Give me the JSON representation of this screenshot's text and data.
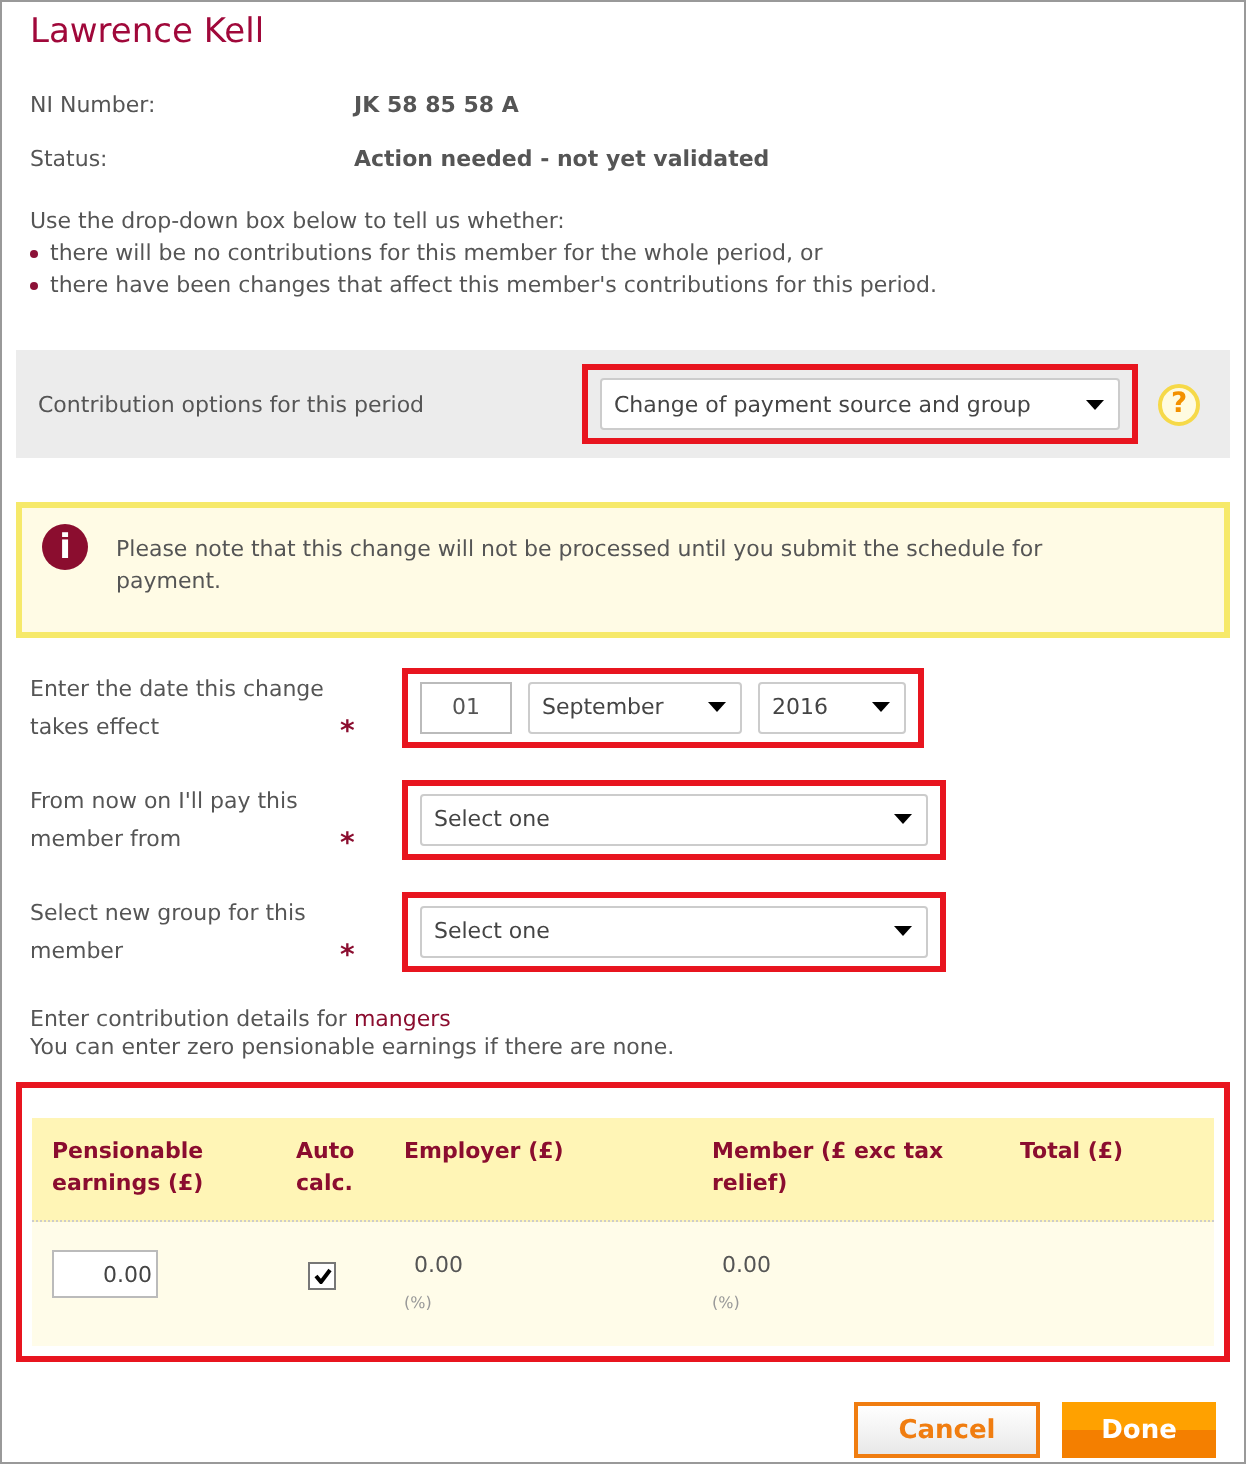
{
  "title": "Lawrence Kell",
  "details": [
    {
      "label": "NI Number:",
      "value": "JK 58 85 58 A"
    },
    {
      "label": "Status:",
      "value": "Action needed - not yet validated"
    }
  ],
  "instructions": {
    "intro": "Use the drop-down box below to tell us whether:",
    "bullets": [
      "there will be no contributions for this member for the whole period, or",
      "there have been changes that affect this member's contributions for this period."
    ]
  },
  "contribution_options": {
    "label": "Contribution options for this period",
    "value": "Change of payment source and group",
    "help": "?"
  },
  "notice": {
    "icon": "i",
    "text": "Please note that this change will not be processed until you submit the schedule for payment."
  },
  "required_mark": "*",
  "date_field": {
    "label": "Enter the date this change takes effect",
    "required": true,
    "day": "01",
    "month": "September",
    "year": "2016"
  },
  "selects": [
    {
      "label": "From now on I'll pay this member from",
      "required": true,
      "value": "Select one"
    },
    {
      "label": "Select new group for this member",
      "required": true,
      "value": "Select one"
    }
  ],
  "contribution_note": {
    "text": "Enter contribution details for ",
    "link": "mangers",
    "hint": "You can enter zero pensionable earnings if there are none."
  },
  "table": {
    "columns": [
      "Pensionable earnings (£)",
      "Auto calc.",
      "Employer (£)",
      "Member (£ exc tax relief)",
      "Total (£)"
    ],
    "row": {
      "earnings": "0.00",
      "auto_calc": true,
      "employer": "0.00",
      "employer_pct": "(%)",
      "member": "0.00",
      "member_pct": "(%)"
    }
  },
  "buttons": [
    {
      "label": "Cancel",
      "kind": "secondary"
    },
    {
      "label": "Done",
      "kind": "primary"
    }
  ]
}
